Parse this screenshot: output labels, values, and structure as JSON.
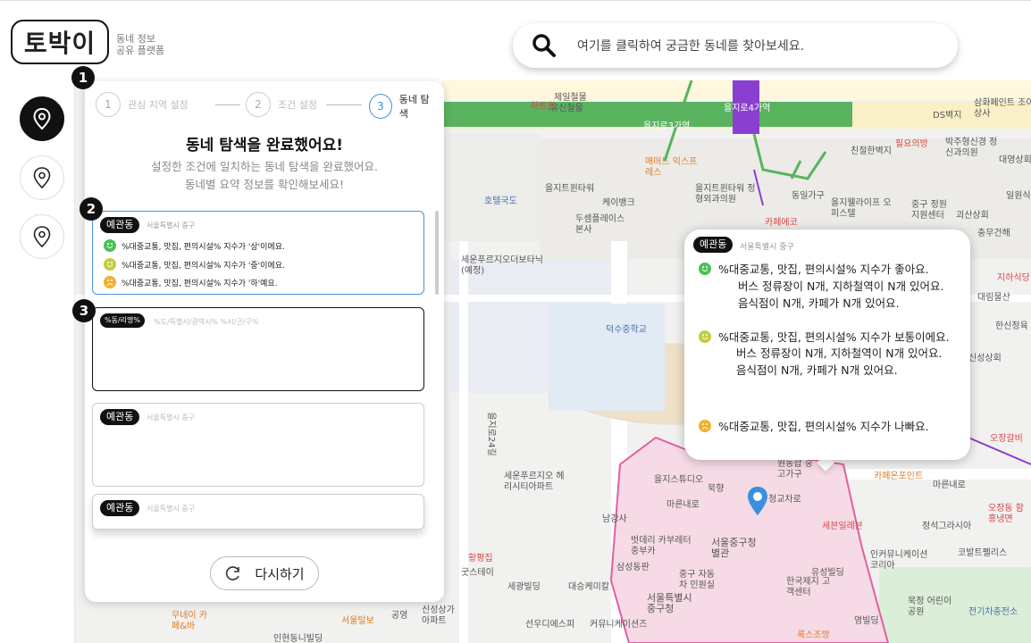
{
  "header": {
    "logo": "토박이",
    "tagline_1": "동네 정보",
    "tagline_2": "공유 플랫폼",
    "search_placeholder": "여기를 클릭하여 궁금한 동네를 찾아보세요."
  },
  "sidenav": {
    "items": [
      {
        "icon": "location-pin-icon",
        "active": true
      },
      {
        "icon": "location-pin-icon",
        "active": false
      },
      {
        "icon": "location-pin-icon",
        "active": false
      }
    ]
  },
  "steps": [
    {
      "number": "1",
      "label": "관심 지역 설정"
    },
    {
      "number": "2",
      "label": "조건 설정"
    },
    {
      "number": "3",
      "label": "동네 탐색",
      "active": true
    }
  ],
  "panel": {
    "title": "동네 탐색을 완료했어요!",
    "subtitle_1": "설정한 조건에 일치하는 동네 탐색을 완료했어요.",
    "subtitle_2": "동네별 요약 정보를 확인해보세요!",
    "reset_label": "다시하기"
  },
  "badges": [
    "1",
    "2",
    "3"
  ],
  "cards": [
    {
      "dong": "예관동",
      "region": "서울특별시 중구",
      "stats": [
        {
          "text": "%대중교통, 맛집, 편의시설% 지수가 '상'이에요.",
          "level": "green"
        },
        {
          "text": "%대중교통, 맛집, 편의시설% 지수가 '중'이에요.",
          "level": "yellow"
        },
        {
          "text": "%대중교통, 맛집, 편의시설% 지수가 '하'예요.",
          "level": "orange"
        }
      ]
    },
    {
      "dong": "%동/리명%",
      "region": "%도/특별시/광역시% %시/군/구%"
    },
    {
      "dong": "예관동",
      "region": "서울특별시 중구"
    },
    {
      "dong": "예관동",
      "region": "서울특별시 중구"
    }
  ],
  "popup": {
    "dong": "예관동",
    "region": "서울특별시 중구",
    "good_title": "%대중교통, 맛집, 편의시설% 지수가 좋아요.",
    "good_line1": "버스 정류장이 N개, 지하철역이 N개 있어요.",
    "good_line2": "음식점이 N개, 카페가 N개 있어요.",
    "mid_title": "%대중교통, 맛집, 편의시설% 지수가 보통이에요.",
    "mid_line1": "버스 정류장이 N개, 지하철역이 N개 있어요.",
    "mid_line2": "음식점이 N개, 카페가 N개 있어요.",
    "bad_title": "%대중교통, 맛집, 편의시설% 지수가 나빠요."
  },
  "map_labels": {
    "l1": "제일철물",
    "l2": "유신철물",
    "l3": "하트원",
    "l4": "을지로3가역",
    "l5": "을지로4가역",
    "l6": "DS벽지",
    "l7": "삼화페인트 조이상사",
    "l8": "친절한벽지",
    "l9": "필요의방",
    "l10": "박주형신경 정신과의원",
    "l11": "대영상회",
    "l12": "매머드 익스프레스",
    "l13": "을지트윈타워",
    "l14": "케이뱅크",
    "l15": "을지트윈타워 정형외과의원",
    "l16": "동일가구",
    "l17": "을지웰라이프 오피스텔",
    "l18": "중구 정원 지원센터",
    "l19": "괴산상회",
    "l20": "일원식",
    "l21": "호텔국도",
    "l22": "두셈플레이스 본사",
    "l23": "카페에코",
    "l24": "충무건해",
    "l25": "세운푸르지오더보타닉 (예정)",
    "l26": "지하식당",
    "l27": "대림물산",
    "l28": "한신정육",
    "l29": "신성상회",
    "l30": "덕수중학교",
    "l31": "세운푸르지오 헤리시티아파트",
    "l32": "을지스튜디오",
    "l33": "묵향",
    "l34": "원동합 중고가구",
    "l35": "카페온포인트",
    "l36": "청교차로",
    "l37": "마른내로",
    "l38": "오장갈비",
    "l39": "오장동 함흥냉면",
    "l40": "정석그라시아",
    "l41": "세븐일레븐",
    "l42": "남강사",
    "l43": "벗데리 카부레터 중부카",
    "l44": "서울중구청 별관",
    "l45": "인커뮤니케이션 코리아",
    "l46": "코발트펠리스",
    "l47": "황평집",
    "l48": "굿스테이",
    "l49": "삼성동판",
    "l50": "중구 자동차 민원실",
    "l51": "세광빌딩",
    "l52": "대승케미칼",
    "l53": "유성빌딩",
    "l54": "한국제지 고객센터",
    "l55": "묵정 어린이공원",
    "l56": "전기차충전소",
    "l57": "서울특별시 중구청",
    "l58": "무네이 카페&바",
    "l59": "공영",
    "l60": "서울털보",
    "l61": "신성상가 아파트",
    "l62": "선우디에스피",
    "l63": "커뮤니케이션즈",
    "l64": "인현동니빌딩",
    "l65": "록스조방",
    "l66": "영빌딩",
    "l67": "을지로24길",
    "l68": "마른내로"
  }
}
